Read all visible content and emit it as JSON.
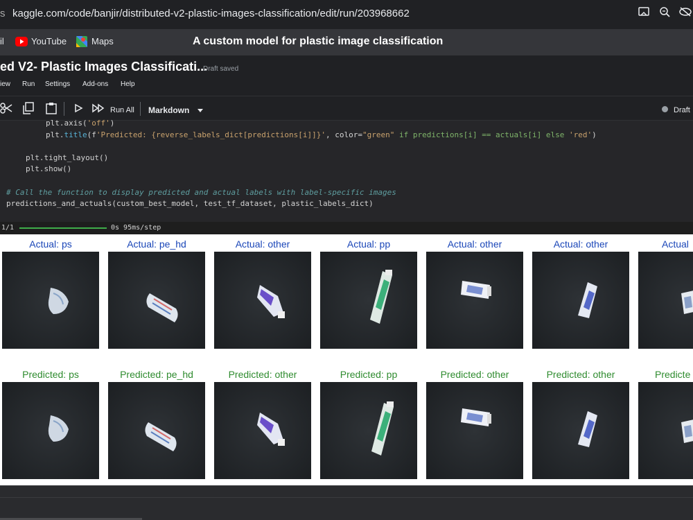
{
  "browser": {
    "url": "kaggle.com/code/banjir/distributed-v2-plastic-images-classification/edit/run/203968662",
    "lead_char": "s",
    "icons": [
      "cast-icon",
      "zoom-icon",
      "visibility-off-icon"
    ]
  },
  "bookmarks": {
    "partial": "il",
    "youtube": "YouTube",
    "maps": "Maps",
    "caption": "A custom model for plastic image classification"
  },
  "notebook": {
    "title": "ed V2- Plastic Images Classificati...",
    "status": "Draft saved",
    "menu": [
      "iew",
      "Run",
      "Settings",
      "Add-ons",
      "Help"
    ],
    "run_all": "Run All",
    "cell_type": "Markdown",
    "right_status": "Draft"
  },
  "code": {
    "line1a": "plt.axis(",
    "line1b": "'off'",
    "line1c": ")",
    "line2a": "plt.",
    "line2b": "title",
    "line2c": "(f",
    "line2d": "'Predicted: {reverse_labels_dict[predictions[i]]}'",
    "line2e": ", color=",
    "line2f": "\"green\"",
    "line2g": " if predictions[i] == actuals[i] else ",
    "line2h": "'red'",
    "line2i": ")",
    "line3": "plt.tight_layout()",
    "line4": "plt.show()",
    "comment": "# Call the function to display predicted and actual labels with label-specific images",
    "call": "predictions_and_actuals(custom_best_model, test_tf_dataset, plastic_labels_dict)"
  },
  "progress": {
    "left": "1/1",
    "right": "0s 95ms/step"
  },
  "output": {
    "actual": [
      "Actual: ps",
      "Actual: pe_hd",
      "Actual: other",
      "Actual: pp",
      "Actual: other",
      "Actual: other",
      "Actual"
    ],
    "predicted": [
      "Predicted: ps",
      "Predicted: pe_hd",
      "Predicted: other",
      "Predicted: pp",
      "Predicted: other",
      "Predicted: other",
      "Predicte"
    ]
  },
  "colors": {
    "actual_label": "#1a46b8",
    "predicted_label": "#2e8b2e"
  }
}
